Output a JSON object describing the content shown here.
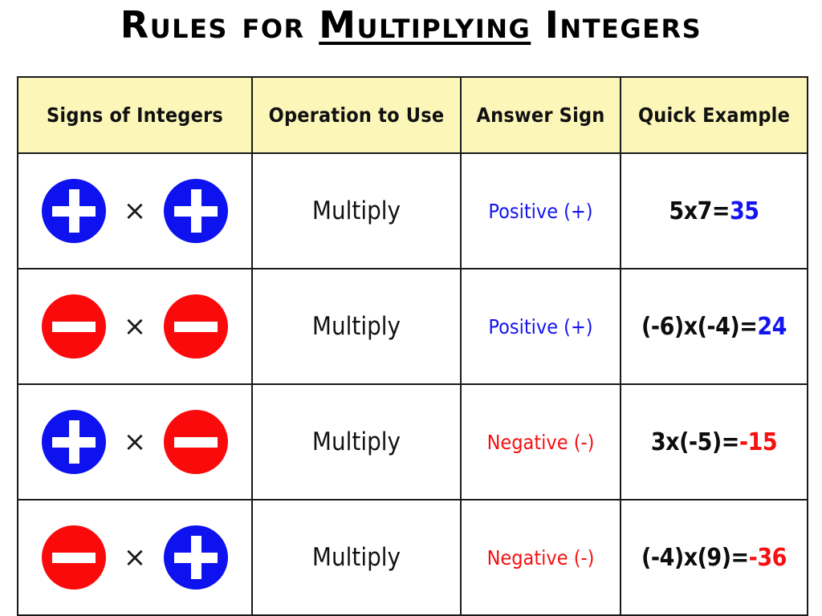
{
  "title": {
    "part1": "Rules for ",
    "underlined": "Multiplying",
    "part2": " Integers",
    "full": "Rules for Multiplying Integers"
  },
  "colors": {
    "positive": "#1414f0",
    "negative": "#f51111",
    "chip_positive": "#0d12ee",
    "chip_negative": "#fa0a0a",
    "header_background": "#fcf6b9",
    "border": "#1a1a1a"
  },
  "table": {
    "headers": [
      "Signs of Integers",
      "Operation to Use",
      "Answer Sign",
      "Quick Example"
    ],
    "multiply_symbol": "×",
    "rows": [
      {
        "sign_left": "positive",
        "sign_right": "positive",
        "sign_left_icon": "plus-circle-blue",
        "sign_right_icon": "plus-circle-blue",
        "operation": "Multiply",
        "answer_sign": "Positive (+)",
        "answer_sign_type": "positive",
        "example_expression": "5x7=",
        "example_result": "35",
        "example_full": "5x7=35"
      },
      {
        "sign_left": "negative",
        "sign_right": "negative",
        "sign_left_icon": "minus-circle-red",
        "sign_right_icon": "minus-circle-red",
        "operation": "Multiply",
        "answer_sign": "Positive (+)",
        "answer_sign_type": "positive",
        "example_expression": "(-6)x(-4)=",
        "example_result": "24",
        "example_full": "(-6)x(-4)=24"
      },
      {
        "sign_left": "positive",
        "sign_right": "negative",
        "sign_left_icon": "plus-circle-blue",
        "sign_right_icon": "minus-circle-red",
        "operation": "Multiply",
        "answer_sign": "Negative (-)",
        "answer_sign_type": "negative",
        "example_expression": "3x(-5)=",
        "example_result": "-15",
        "example_full": "3x(-5)=-15"
      },
      {
        "sign_left": "negative",
        "sign_right": "positive",
        "sign_left_icon": "minus-circle-red",
        "sign_right_icon": "plus-circle-blue",
        "operation": "Multiply",
        "answer_sign": "Negative (-)",
        "answer_sign_type": "negative",
        "example_expression": "(-4)x(9)=",
        "example_result": "-36",
        "example_full": "(-4)x(9)=-36"
      }
    ]
  }
}
